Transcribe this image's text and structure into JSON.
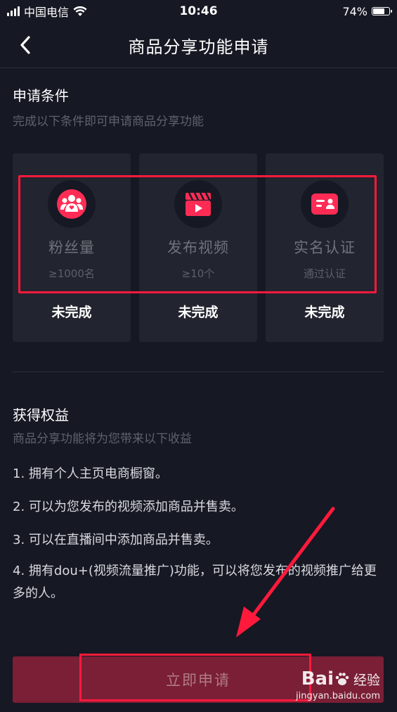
{
  "status_bar": {
    "carrier": "中国电信",
    "time": "10:46",
    "battery": "74%",
    "battery_level": 0.74
  },
  "nav": {
    "title": "商品分享功能申请",
    "back_icon": "chevron-left-icon"
  },
  "conditions": {
    "title": "申请条件",
    "subtitle": "完成以下条件即可申请商品分享功能",
    "cards": [
      {
        "icon": "fans-icon",
        "name": "粉丝量",
        "requirement": "≥1000名",
        "status": "未完成"
      },
      {
        "icon": "video-clapper-icon",
        "name": "发布视频",
        "requirement": "≥10个",
        "status": "未完成"
      },
      {
        "icon": "id-card-icon",
        "name": "实名认证",
        "requirement": "通过认证",
        "status": "未完成"
      }
    ]
  },
  "benefits": {
    "title": "获得权益",
    "subtitle": "商品分享功能将为您带来以下收益",
    "items": [
      "1. 拥有个人主页电商橱窗。",
      "2. 可以为您发布的视频添加商品并售卖。",
      "3. 可以在直播间中添加商品并售卖。",
      "4. 拥有dou+(视频流量推广)功能，可以将您发布的视频推广给更多的人。"
    ]
  },
  "apply_button": {
    "label": "立即申请"
  },
  "watermark": {
    "brand": "Bai",
    "brand_suffix": "经验",
    "url": "jingyan.baidu.com"
  },
  "colors": {
    "background": "#161823",
    "card": "#22242f",
    "accent": "#fe2c55",
    "highlight": "#ff1a3c",
    "button": "#7a1f36"
  }
}
